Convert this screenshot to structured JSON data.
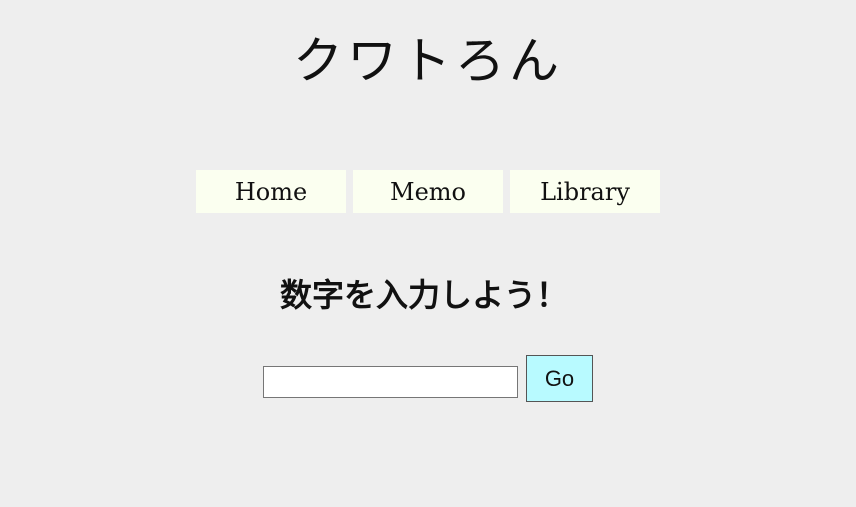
{
  "site": {
    "title": "クワトろん"
  },
  "nav": {
    "items": [
      {
        "label": "Home"
      },
      {
        "label": "Memo"
      },
      {
        "label": "Library"
      }
    ]
  },
  "main": {
    "prompt": "数字を入力しよう！",
    "input_value": "",
    "input_placeholder": "",
    "go_label": "Go"
  },
  "colors": {
    "background": "#eeeeee",
    "nav_item_bg": "#fbfff0",
    "go_button_bg": "#b8faff"
  }
}
